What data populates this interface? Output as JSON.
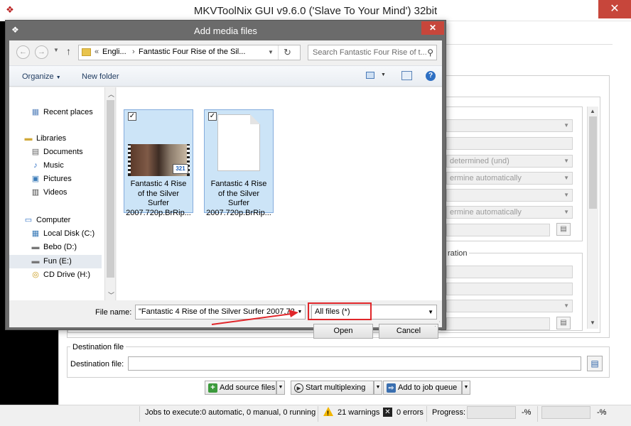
{
  "main": {
    "title": "MKVToolNix GUI v9.6.0 ('Slave To Your Mind') 32bit",
    "close_glyph": "✕",
    "background_props": {
      "lang": "determined (und)",
      "mode1": "ermine automatically",
      "mode2": "ermine automatically",
      "group_label": "ration"
    },
    "destination": {
      "group_label": "Destination file",
      "field_label": "Destination file:",
      "value": ""
    },
    "toolbar": {
      "add_source": "Add source files",
      "start_mux": "Start multiplexing",
      "add_queue": "Add to job queue"
    },
    "status": {
      "jobs_label": "Jobs to execute:",
      "jobs_value": "0 automatic, 0 manual, 0 running",
      "warnings": "21 warnings",
      "errors": "0 errors",
      "progress_label": "Progress:",
      "progress_pct1": "-%",
      "progress_pct2": "-%"
    }
  },
  "dialog": {
    "title": "Add media files",
    "close_glyph": "✕",
    "breadcrumb": {
      "prefix": "«",
      "item1": "Engli...",
      "sep": "›",
      "item2": "Fantastic Four Rise of the Sil..."
    },
    "search_placeholder": "Search Fantastic Four Rise of t...",
    "cmd": {
      "organize": "Organize",
      "new_folder": "New folder"
    },
    "nav": {
      "recent": "Recent places",
      "libraries": "Libraries",
      "documents": "Documents",
      "music": "Music",
      "pictures": "Pictures",
      "videos": "Videos",
      "computer": "Computer",
      "local_disk": "Local Disk (C:)",
      "bebo": "Bebo (D:)",
      "fun": "Fun (E:)",
      "cd_drive": "CD Drive (H:)"
    },
    "files": [
      {
        "name_line1": "Fantastic 4 Rise",
        "name_line2": "of the Silver",
        "name_line3": "Surfer",
        "name_line4": "2007.720p.BrRip...",
        "badge": "321"
      },
      {
        "name_line1": "Fantastic 4 Rise",
        "name_line2": "of the Silver",
        "name_line3": "Surfer",
        "name_line4": "2007.720p.BrRip..."
      }
    ],
    "filename_label": "File name:",
    "filename_value": "\"Fantastic 4 Rise of the Silver Surfer 2007.720p",
    "filter_value": "All files  (*)",
    "open_label": "Open",
    "cancel_label": "Cancel"
  },
  "colors": {
    "highlight_red": "#e0262a",
    "close_red": "#c7463b",
    "dialog_frame": "#6b6b6b",
    "selection_blue": "#cce4f7"
  }
}
